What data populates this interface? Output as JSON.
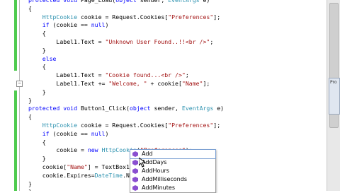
{
  "code_lines": [
    "protected void Page_Load(object sender, EventArgs e)",
    "{",
    "    HttpCookie cookie = Request.Cookies[\"Preferences\"];",
    "    if (cookie == null)",
    "    {",
    "        Label1.Text = \"Unknown User Found..!!<br />\";",
    "    }",
    "    else",
    "    {",
    "        Label1.Text = \"Cookie found...<br />\";",
    "        Label1.Text += \"Welcome, \" + cookie[\"Name\"];",
    "    }",
    "}",
    "protected void Button1_Click(object sender, EventArgs e)",
    "{",
    "    HttpCookie cookie = Request.Cookies[\"Preferences\"];",
    "    if (cookie == null)",
    "    {",
    "        cookie = new HttpCookie(\"Preferences\");",
    "    }",
    "    cookie[\"Name\"] = TextBox1.Text;",
    "    cookie.Expires=DateTime.Now.add",
    "}",
    "}"
  ],
  "intellisense": {
    "items": [
      "Add",
      "AddDays",
      "AddHours",
      "AddMilliseconds",
      "AddMinutes"
    ],
    "selected": "Add"
  },
  "side_tab": {
    "label": "Pro"
  },
  "colors": {
    "keyword": "#0000ff",
    "type": "#2b91af",
    "string": "#a31515",
    "change_bar": "#4fcb4f",
    "selection_border": "#7a9fd2"
  }
}
